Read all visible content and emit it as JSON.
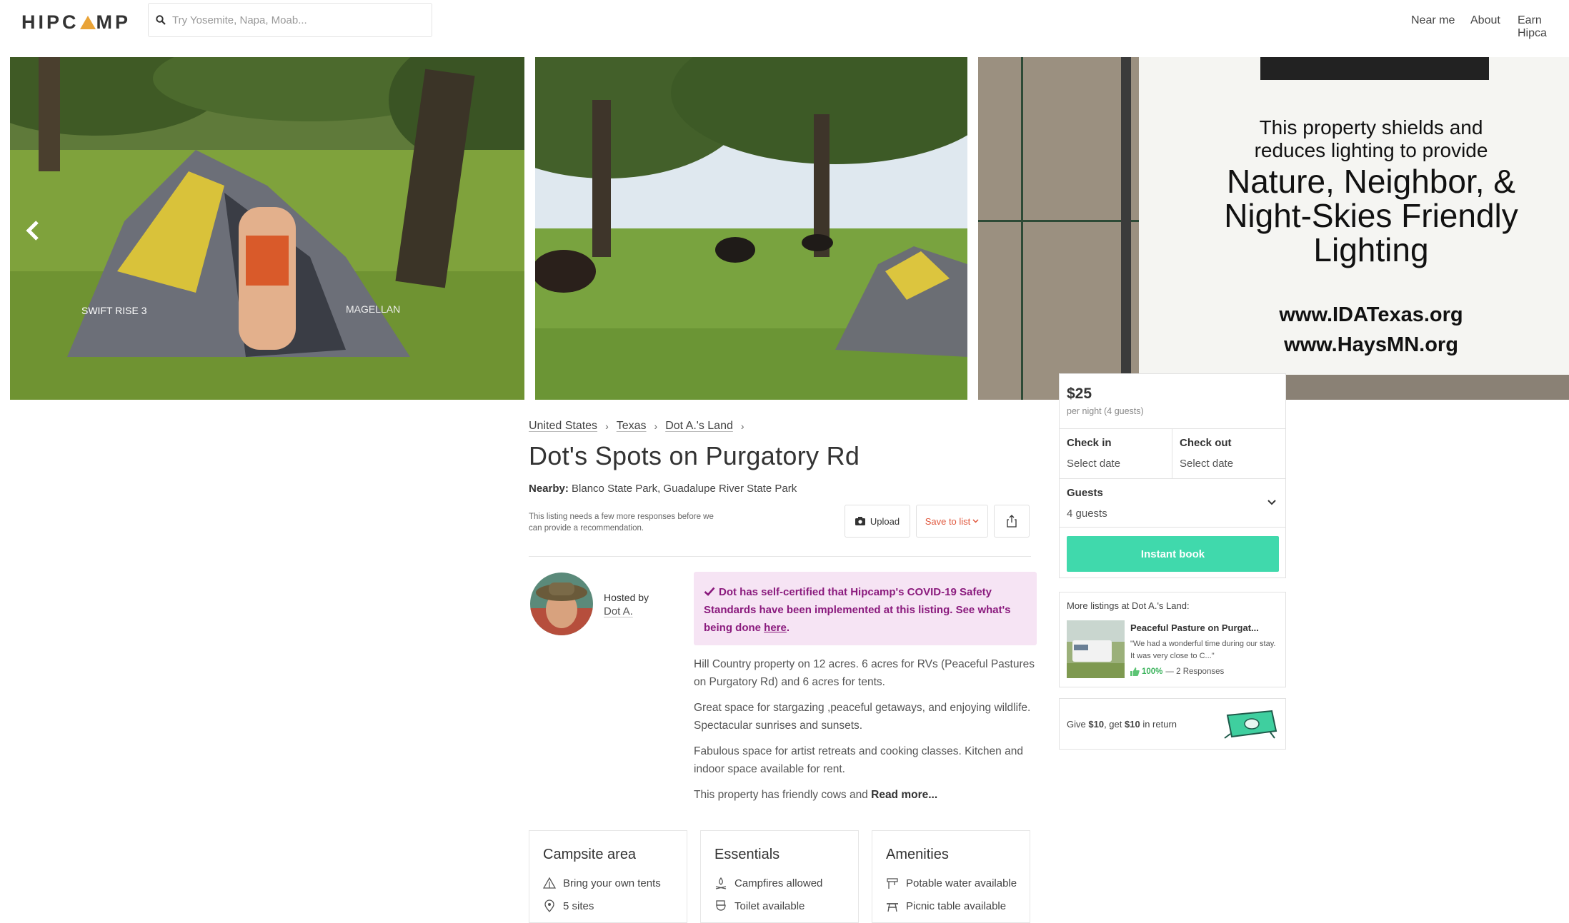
{
  "header": {
    "logo": "HIPCAMP",
    "search_placeholder": "Try Yosemite, Napa, Moab...",
    "nav": [
      "Near me",
      "About",
      "Earn Hipca"
    ]
  },
  "breadcrumb": [
    "United States",
    "Texas",
    "Dot A.'s Land"
  ],
  "listing": {
    "title": "Dot's Spots on Purgatory Rd",
    "nearby_label": "Nearby:",
    "nearby": "Blanco State Park, Guadalupe River State Park",
    "recommendation_note": "This listing needs a few more responses before we can provide a recommendation."
  },
  "actions": {
    "upload": "Upload",
    "save": "Save to list"
  },
  "host": {
    "hosted_by": "Hosted by",
    "name": "Dot A."
  },
  "covid": {
    "text": "Dot has self-certified that Hipcamp's COVID-19 Safety Standards have been implemented at this listing. See what's being done",
    "link": "here",
    "end": "."
  },
  "description": [
    "Hill Country property on 12 acres. 6 acres for RVs (Peaceful Pastures on Purgatory Rd) and 6 acres for tents.",
    "Great space for stargazing ,peaceful getaways, and enjoying wildlife. Spectacular sunrises and sunsets.",
    "Fabulous space for artist retreats and cooking classes.  Kitchen and indoor space available for rent."
  ],
  "description_last": "This property has friendly cows and",
  "read_more": "Read more...",
  "features": {
    "campsite": {
      "title": "Campsite area",
      "items": [
        "Bring your own tents",
        "5 sites"
      ]
    },
    "essentials": {
      "title": "Essentials",
      "items": [
        "Campfires allowed",
        "Toilet available"
      ]
    },
    "amenities": {
      "title": "Amenities",
      "items": [
        "Potable water available",
        "Picnic table available"
      ]
    }
  },
  "booking": {
    "price": "$25",
    "per_night": "per night (4 guests)",
    "check_in_label": "Check in",
    "check_in_value": "Select date",
    "check_out_label": "Check out",
    "check_out_value": "Select date",
    "guests_label": "Guests",
    "guests_value": "4 guests",
    "button": "Instant book"
  },
  "more_listings": {
    "heading": "More listings at Dot A.'s Land:",
    "title": "Peaceful Pasture on Purgat...",
    "quote": "\"We had a wonderful time during our stay. It was very close to C...\"",
    "percent": "100%",
    "responses": "— 2 Responses"
  },
  "referral": {
    "give": "Give",
    "amount1": "$10",
    "get": ", get",
    "amount2": "$10",
    "rest": "in return"
  },
  "sign": {
    "line1": "This property shields and",
    "line2": "reduces lighting to provide",
    "line3": "Nature, Neighbor, &",
    "line4": "Night-Skies Friendly",
    "line5": "Lighting",
    "url1": "www.IDATexas.org",
    "url2": "www.HaysMN.org"
  },
  "tent_labels": {
    "brand": "MAGELLAN",
    "model": "SWIFT RISE 3"
  }
}
